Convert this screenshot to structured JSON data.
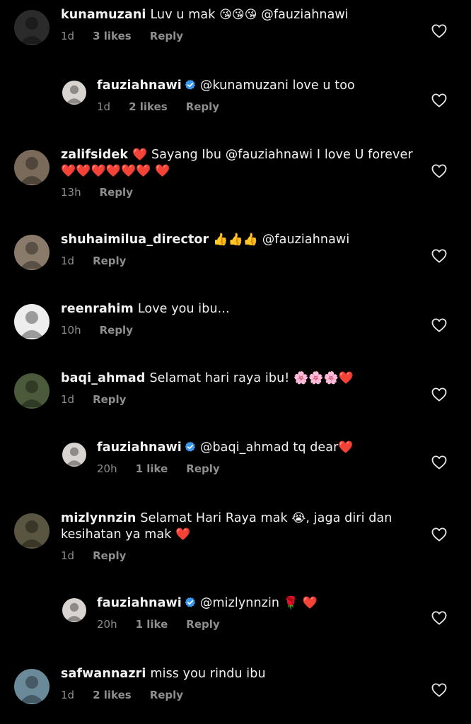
{
  "comments": [
    {
      "user": "kunamuzani",
      "verified": false,
      "reply": false,
      "text": "Luv u mak 😘😘😘 @fauziahnawi",
      "time": "1d",
      "likes": "3 likes",
      "reply_label": "Reply",
      "avatar_color": "#2b2b2b"
    },
    {
      "user": "fauziahnawi",
      "verified": true,
      "reply": true,
      "text": "@kunamuzani love u too",
      "time": "1d",
      "likes": "2 likes",
      "reply_label": "Reply",
      "avatar_color": "#d9d4cf"
    },
    {
      "user": "zalifsidek",
      "verified": false,
      "reply": false,
      "text": "❤️ Sayang Ibu @fauziahnawi I love U forever ❤️❤️❤️❤️❤️❤️ ❤️",
      "time": "13h",
      "likes": "",
      "reply_label": "Reply",
      "avatar_color": "#7a6a5a"
    },
    {
      "user": "shuhaimilua_director",
      "verified": false,
      "reply": false,
      "text": "👍👍👍 @fauziahnawi",
      "time": "1d",
      "likes": "",
      "reply_label": "Reply",
      "avatar_color": "#8a7a6a"
    },
    {
      "user": "reenrahim",
      "verified": false,
      "reply": false,
      "text": "Love you ibu...",
      "time": "10h",
      "likes": "",
      "reply_label": "Reply",
      "avatar_color": "#eeeeee"
    },
    {
      "user": "baqi_ahmad",
      "verified": false,
      "reply": false,
      "text": "Selamat hari raya ibu! 🌸🌸🌸❤️",
      "time": "1d",
      "likes": "",
      "reply_label": "Reply",
      "avatar_color": "#4a5a3a"
    },
    {
      "user": "fauziahnawi",
      "verified": true,
      "reply": true,
      "text": "@baqi_ahmad tq dear❤️",
      "time": "20h",
      "likes": "1 like",
      "reply_label": "Reply",
      "avatar_color": "#d9d4cf"
    },
    {
      "user": "mizlynnzin",
      "verified": false,
      "reply": false,
      "text": "Selamat Hari Raya mak 😭, jaga diri dan kesihatan ya mak ❤️",
      "time": "1d",
      "likes": "",
      "reply_label": "Reply",
      "avatar_color": "#5a5540"
    },
    {
      "user": "fauziahnawi",
      "verified": true,
      "reply": true,
      "text": "@mizlynnzin 🌹 ❤️",
      "time": "20h",
      "likes": "1 like",
      "reply_label": "Reply",
      "avatar_color": "#d9d4cf"
    },
    {
      "user": "safwannazri",
      "verified": false,
      "reply": false,
      "text": "miss you rindu ibu",
      "time": "1d",
      "likes": "2 likes",
      "reply_label": "Reply",
      "avatar_color": "#6a8a9a"
    }
  ],
  "icons": {
    "like": "heart-outline-icon",
    "verified": "verified-badge-icon"
  },
  "colors": {
    "background": "#000000",
    "text": "#f2f2f2",
    "meta": "#8e8e8e",
    "verified": "#3897f0"
  }
}
